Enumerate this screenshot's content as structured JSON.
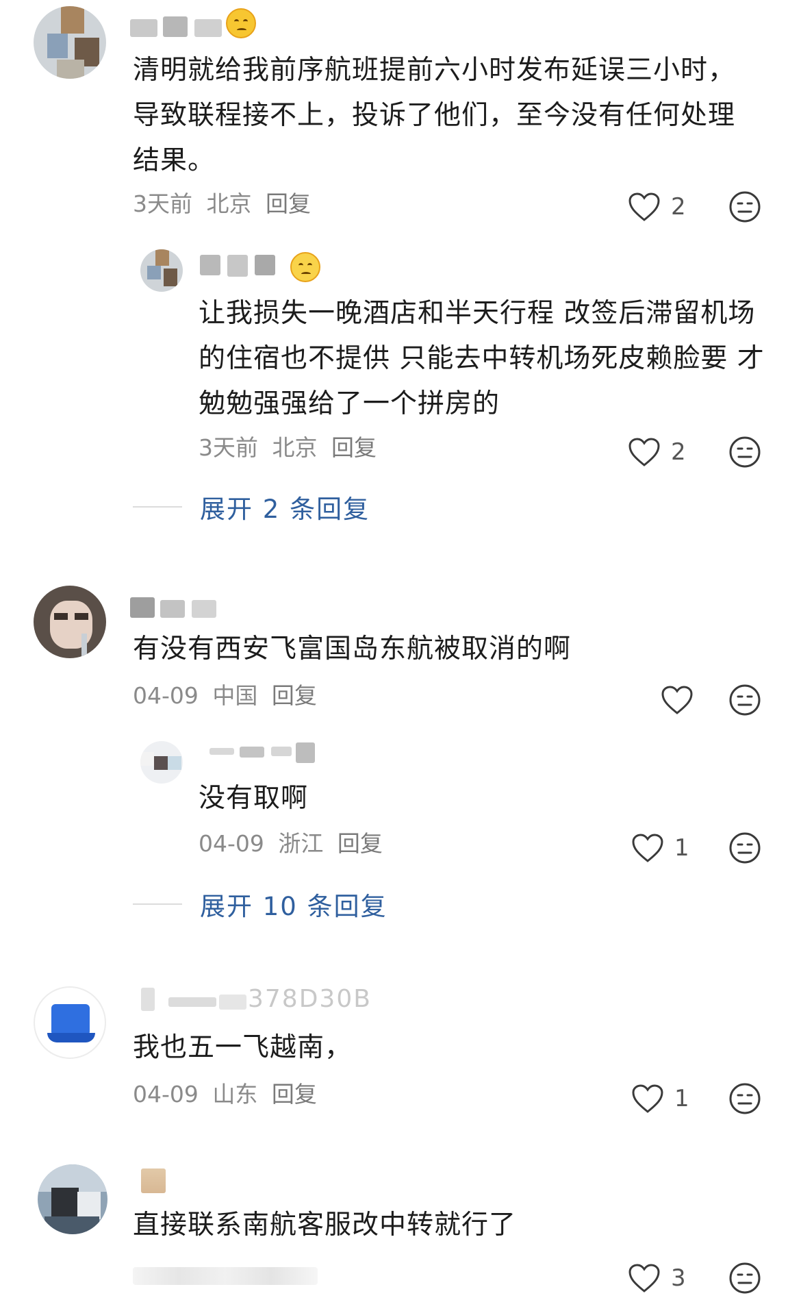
{
  "comments": [
    {
      "text": "清明就给我前序航班提前六小时发布延误三小时，导致联程接不上，投诉了他们，至今没有任何处理结果。",
      "time": "3天前",
      "location": "北京",
      "reply_label": "回复",
      "likes": "2",
      "replies": [
        {
          "text": "让我损失一晚酒店和半天行程 改签后滞留机场的住宿也不提供 只能去中转机场死皮赖脸要 才勉勉强强给了一个拼房的",
          "time": "3天前",
          "location": "北京",
          "reply_label": "回复",
          "likes": "2"
        }
      ],
      "expand_label": "展开 2 条回复"
    },
    {
      "text": "有没有西安飞富国岛东航被取消的啊",
      "time": "04-09",
      "location": "中国",
      "reply_label": "回复",
      "likes": "",
      "replies": [
        {
          "text": "没有取啊",
          "time": "04-09",
          "location": "浙江",
          "reply_label": "回复",
          "likes": "1"
        }
      ],
      "expand_label": "展开 10 条回复"
    },
    {
      "name_visible": "378D30B",
      "text": "我也五一飞越南，",
      "time": "04-09",
      "location": "山东",
      "reply_label": "回复",
      "likes": "1"
    },
    {
      "text": "直接联系南航客服改中转就行了",
      "likes": "3"
    }
  ],
  "icons": {
    "like": "heart-outline-icon",
    "react": "meh-face-icon"
  },
  "colors": {
    "link": "#2f5f9e",
    "meta": "#8a8a8a",
    "text": "#1c1c1c"
  }
}
